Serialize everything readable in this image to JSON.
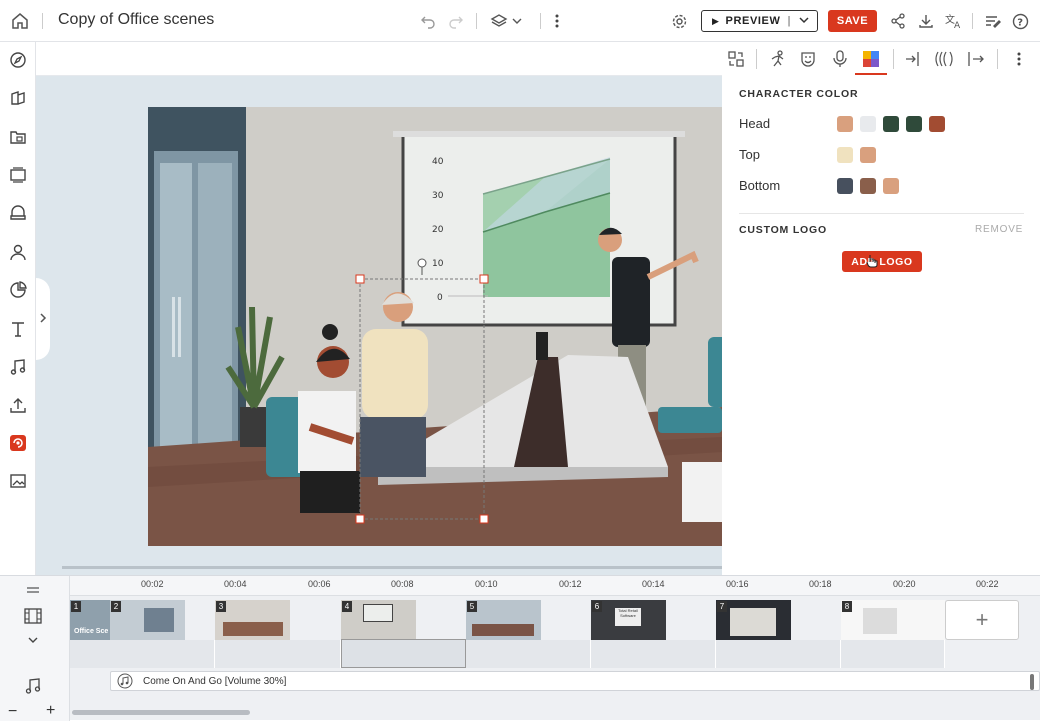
{
  "header": {
    "title": "Copy of Office scenes",
    "preview_label": "PREVIEW",
    "save_label": "SAVE"
  },
  "panel": {
    "character_color_title": "CHARACTER COLOR",
    "rows": [
      {
        "label": "Head",
        "swatches": [
          "#d9a07e",
          "#e8eaed",
          "#2f4a3a",
          "#2f4a3a",
          "#a24c32"
        ]
      },
      {
        "label": "Top",
        "swatches": [
          "#f0e2bf",
          "#d9a07e"
        ]
      },
      {
        "label": "Bottom",
        "swatches": [
          "#47505e",
          "#8a5f4b",
          "#d9a07e"
        ]
      }
    ],
    "custom_logo_title": "CUSTOM LOGO",
    "remove_label": "REMOVE",
    "add_logo_label": "ADD LOGO"
  },
  "scene": {
    "chart_ticks": [
      "40",
      "30",
      "20",
      "10",
      "0"
    ]
  },
  "timeline": {
    "ruler_ticks": [
      "00:02",
      "00:04",
      "00:06",
      "00:08",
      "00:10",
      "00:12",
      "00:14",
      "00:16",
      "00:18",
      "00:20",
      "00:22"
    ],
    "scenes": [
      {
        "num": "1",
        "caption": "Office Sce"
      },
      {
        "num": "2",
        "caption": ""
      },
      {
        "num": "3",
        "caption": ""
      },
      {
        "num": "4",
        "caption": ""
      },
      {
        "num": "5",
        "caption": ""
      },
      {
        "num": "6",
        "caption": "Total Retail Software"
      },
      {
        "num": "7",
        "caption": ""
      },
      {
        "num": "8",
        "caption": ""
      }
    ],
    "audio_label": "Come On And Go [Volume 30%]"
  },
  "colors": {
    "accent": "#d9381e",
    "canvas_bg": "#dde6ec"
  }
}
